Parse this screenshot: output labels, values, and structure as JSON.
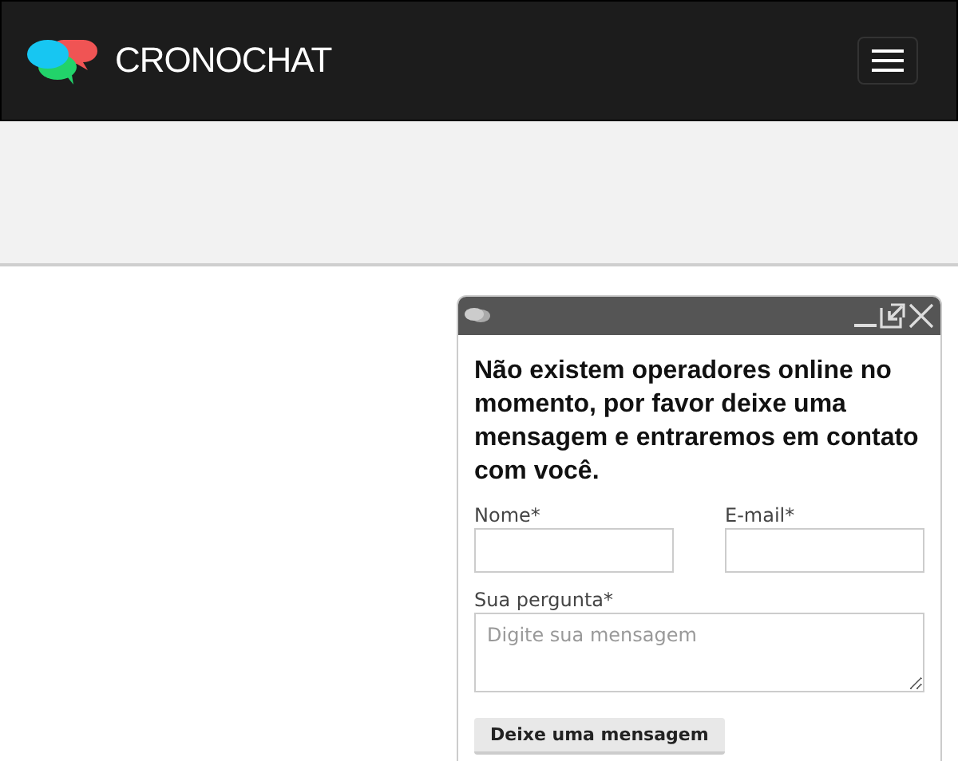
{
  "navbar": {
    "brand": "CRONOCHAT"
  },
  "chat_widget": {
    "message": "Não existem operadores online no momento, por favor deixe uma mensagem e entraremos em contato com você.",
    "fields": [
      {
        "label": "Nome*",
        "kind": "input"
      },
      {
        "label": "E-mail*",
        "kind": "input"
      }
    ],
    "question": {
      "label": "Sua pergunta*",
      "placeholder": "Digite sua mensagem"
    },
    "submit": "Deixe uma mensagem"
  }
}
